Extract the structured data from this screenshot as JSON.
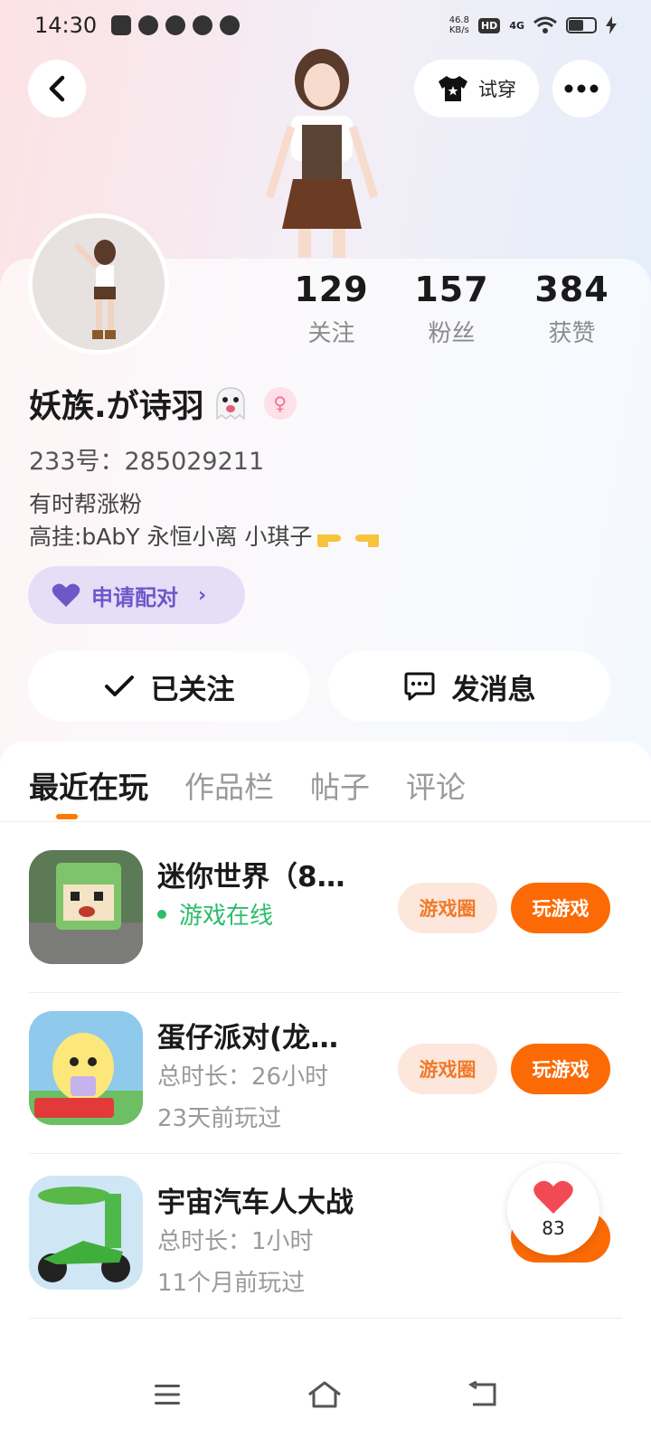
{
  "status_bar": {
    "time": "14:30",
    "net_speed_value": "46.8",
    "net_speed_unit": "KB/s",
    "hd_label": "HD",
    "network_label": "4G"
  },
  "top_bar": {
    "tryon_label": "试穿"
  },
  "stats": [
    {
      "value": "129",
      "label": "关注"
    },
    {
      "value": "157",
      "label": "粉丝"
    },
    {
      "value": "384",
      "label": "获赞"
    }
  ],
  "profile": {
    "name": "妖族.が诗羽",
    "id_line": "233号：285029211",
    "bio_line1": "有时帮涨粉",
    "bio_line2": "高挂:bAbY  永恒小离  小琪子"
  },
  "match_button": {
    "label": "申请配对"
  },
  "actions": {
    "follow_label": "已关注",
    "message_label": "发消息"
  },
  "tabs": [
    "最近在玩",
    "作品栏",
    "帖子",
    "评论"
  ],
  "games": [
    {
      "title": "迷你世界（8…",
      "status": "游戏在线",
      "circle_label": "游戏圈",
      "play_label": "玩游戏"
    },
    {
      "title": "蛋仔派对(龙…",
      "duration": "总时长：26小时",
      "last_played": "23天前玩过",
      "circle_label": "游戏圈",
      "play_label": "玩游戏"
    },
    {
      "title": "宇宙汽车人大战",
      "duration": "总时长：1小时",
      "last_played": "11个月前玩过"
    }
  ],
  "like_float": {
    "count": "83"
  },
  "colors": {
    "accent_orange": "#fb6a05",
    "online_green": "#2cbd6b",
    "match_purple": "#6d58c8"
  }
}
